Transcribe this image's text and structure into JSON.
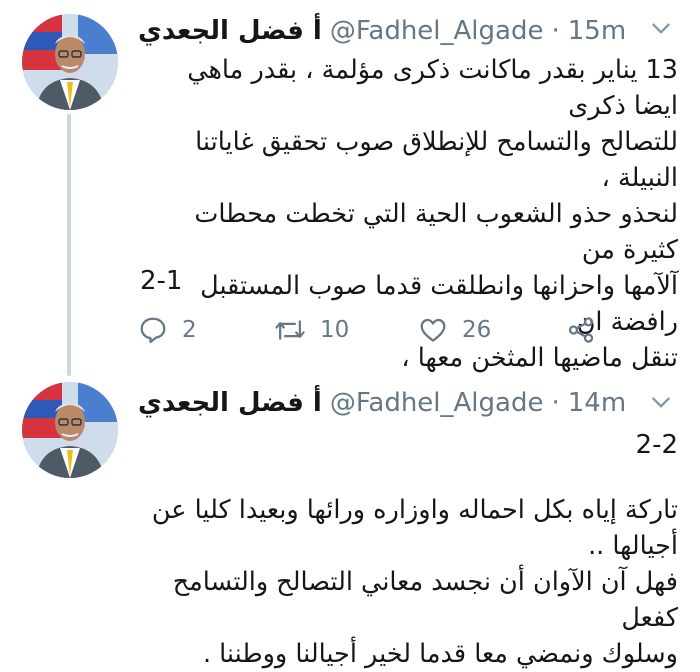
{
  "colors": {
    "text": "#14171a",
    "secondary": "#657786",
    "thread_line": "#ccd6dd"
  },
  "tweets": [
    {
      "name": "أ فضل الجعدي",
      "handle": "@Fadhel_Algade",
      "separator": "·",
      "time": "15m",
      "text": "13 يناير بقدر ماكانت ذكرى مؤلمة ، بقدر ماهي ايضا ذكرى\nللتصالح والتسامح للإنطلاق صوب تحقيق غاياتنا النبيلة ،\nلنحذو حذو الشعوب الحية التي تخطت محطات كثيرة من\nآلآمها واحزانها وانطلقت قدما صوب المستقبل رافضة ان\nتنقل ماضيها المثخن معها ،",
      "part": "2-1",
      "replies": "2",
      "retweets": "10",
      "likes": "26"
    },
    {
      "name": "أ فضل الجعدي",
      "handle": "@Fadhel_Algade",
      "separator": "·",
      "time": "14m",
      "part": "2-2",
      "text": "تاركة إياه بكل احماله واوزاره ورائها وبعيدا كليا عن\nأجيالها ..\nفهل آن الآوان أن نجسد معاني التصالح والتسامح كفعل\nوسلوك ونمضي معا قدما لخير أجيالنا ووطننا ."
    }
  ],
  "icons": [
    "caret-down-icon",
    "reply-icon",
    "retweet-icon",
    "like-icon",
    "share-icon"
  ]
}
